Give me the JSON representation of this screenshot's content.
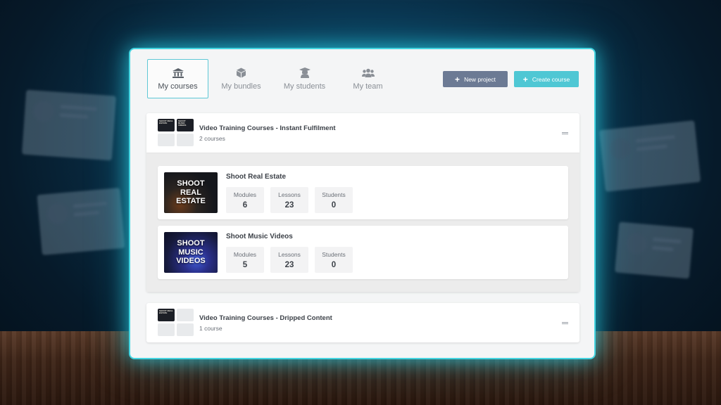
{
  "tabs": [
    {
      "label": "My courses",
      "icon": "bank-icon",
      "active": true
    },
    {
      "label": "My bundles",
      "icon": "box-icon",
      "active": false
    },
    {
      "label": "My students",
      "icon": "graduation-cap-icon",
      "active": false
    },
    {
      "label": "My team",
      "icon": "team-icon",
      "active": false
    }
  ],
  "toolbar": {
    "new_project_label": "New project",
    "create_course_label": "Create course"
  },
  "colors": {
    "accent": "#4fc7d4",
    "secondary_button": "#6c7a94",
    "window_glow": "#43d4e0"
  },
  "projects": [
    {
      "title": "Video Training Courses - Instant Fulfilment",
      "subtitle": "2 courses",
      "thumb_labels": [
        "SHOOT REAL ESTATE",
        "SHOOT MUSIC VIDEOS"
      ],
      "courses": [
        {
          "title": "Shoot Real Estate",
          "thumb_lines": [
            "SHOOT",
            "REAL",
            "ESTATE"
          ],
          "stats": [
            {
              "label": "Modules",
              "value": "6"
            },
            {
              "label": "Lessons",
              "value": "23"
            },
            {
              "label": "Students",
              "value": "0"
            }
          ]
        },
        {
          "title": "Shoot Music Videos",
          "thumb_lines": [
            "SHOOT",
            "MUSIC",
            "VIDEOS"
          ],
          "stats": [
            {
              "label": "Modules",
              "value": "5"
            },
            {
              "label": "Lessons",
              "value": "23"
            },
            {
              "label": "Students",
              "value": "0"
            }
          ]
        }
      ]
    },
    {
      "title": "Video Training Courses - Dripped Content",
      "subtitle": "1 course",
      "thumb_labels": [
        "SHOOT REAL ESTATE"
      ],
      "courses": []
    }
  ]
}
